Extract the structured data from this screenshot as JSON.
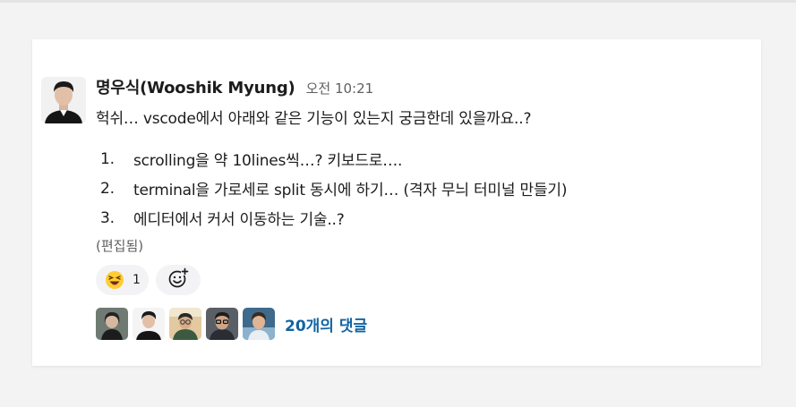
{
  "message": {
    "author": "명우식(Wooshik Myung)",
    "timestamp": "오전 10:21",
    "text": "헉쉬… vscode에서 아래와 같은 기능이 있는지 궁금한데 있을까요..?",
    "list": [
      {
        "num": "1.",
        "text": "scrolling을 약 10lines씩…? 키보드로…."
      },
      {
        "num": "2.",
        "text": "terminal을 가로세로 split 동시에 하기… (격자 무늬 터미널 만들기)"
      },
      {
        "num": "3.",
        "text": "에디터에서 커서 이동하는 기술..?"
      }
    ],
    "edited_label": "(편집됨)"
  },
  "reactions": [
    {
      "emoji": "laughing-face",
      "count": "1"
    }
  ],
  "add_reaction_icon": "add-emoji-icon",
  "thread": {
    "reply_label": "20개의 댓글",
    "participants": [
      "participant-1",
      "participant-2",
      "participant-3",
      "participant-4",
      "participant-5"
    ]
  },
  "colors": {
    "link": "#1264a3",
    "text": "#1d1c1d",
    "muted": "#616061",
    "pill": "#f3f3f5"
  }
}
